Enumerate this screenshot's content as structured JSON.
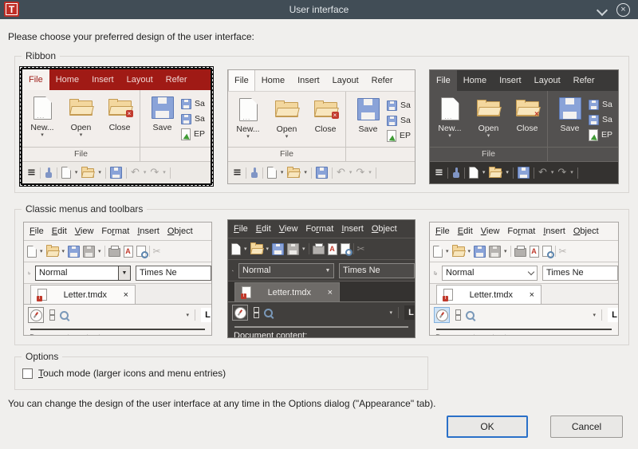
{
  "window": {
    "title": "User interface"
  },
  "intro": "Please choose your preferred design of the user interface:",
  "icons": {
    "app_letter": "T",
    "close": "×",
    "hamburger": "≡",
    "dropdown": "▾",
    "undo": "↶",
    "redo": "↷",
    "scissors": "✂",
    "combo_arrow": "▼"
  },
  "ribbon_section": {
    "label": "Ribbon",
    "tabs": [
      "File",
      "Home",
      "Insert",
      "Layout",
      "Refer"
    ],
    "items": {
      "new": "New...",
      "open": "Open",
      "close": "Close",
      "save": "Save"
    },
    "mini_items": [
      "Sa",
      "Sa",
      "EP"
    ],
    "group_label": "File"
  },
  "classic_section": {
    "label": "Classic menus and toolbars",
    "menus": [
      {
        "t": "File",
        "u": 0
      },
      {
        "t": "Edit",
        "u": 0
      },
      {
        "t": "View",
        "u": 0
      },
      {
        "t": "Format",
        "u": 2
      },
      {
        "t": "Insert",
        "u": 0
      },
      {
        "t": "Object",
        "u": 0
      }
    ],
    "paragraph_style": "Normal",
    "font_name": "Times Ne",
    "document_tab": "Letter.tmdx",
    "ruler_letter": "L",
    "document_content": "Document content:"
  },
  "options_section": {
    "label": "Options",
    "touch_mode": {
      "t": "Touch mode (larger icons and menu entries)",
      "u": 0
    },
    "checked": false
  },
  "footer_note": "You can change the design of the user interface at any time in the Options dialog (\"Appearance\" tab).",
  "buttons": {
    "ok": "OK",
    "cancel": "Cancel"
  },
  "colors": {
    "accent_red": "#a01a15",
    "titlebar": "#414d56",
    "ok_border": "#2a70c8"
  }
}
